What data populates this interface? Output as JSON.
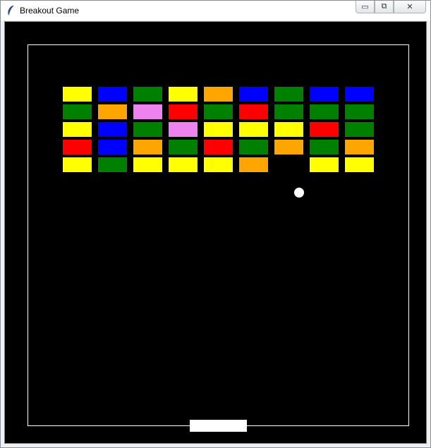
{
  "window": {
    "title": "Breakout Game"
  },
  "controls": {
    "minimize": "▭",
    "restore": "⧉",
    "close": "✕"
  },
  "icons": {
    "app": "feather-icon"
  },
  "colors": {
    "Y": "#ffff00",
    "B": "#0000ff",
    "G": "#008000",
    "O": "#ffa500",
    "R": "#ff0000",
    "P": "#ee82ee"
  },
  "bricks": [
    [
      "Y",
      "B",
      "G",
      "Y",
      "O",
      "B",
      "G",
      "B",
      "B"
    ],
    [
      "G",
      "O",
      "P",
      "R",
      "G",
      "R",
      "G",
      "G",
      "G"
    ],
    [
      "Y",
      "B",
      "G",
      "P",
      "Y",
      "Y",
      "Y",
      "R",
      "G"
    ],
    [
      "R",
      "B",
      "O",
      "G",
      "R",
      "G",
      "O",
      "G",
      "O"
    ],
    [
      "Y",
      "G",
      "Y",
      "Y",
      "Y",
      "O",
      "",
      "Y",
      "Y"
    ]
  ]
}
